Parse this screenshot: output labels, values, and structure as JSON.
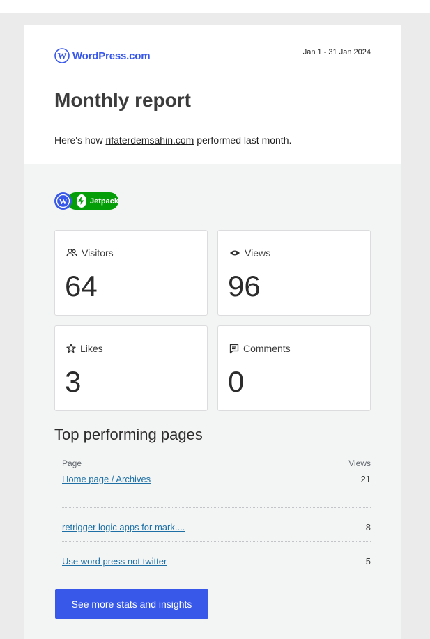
{
  "header": {
    "brand": "WordPress.com",
    "date_range": "Jan 1 - 31 Jan 2024",
    "title": "Monthly report",
    "intro_before": "Here's how ",
    "site_link": "rifaterdemsahin.com",
    "intro_after": " performed last month."
  },
  "badges": {
    "jetpack_label": "Jetpack"
  },
  "stats": [
    {
      "label": "Visitors",
      "value": "64",
      "icon": "people-icon"
    },
    {
      "label": "Views",
      "value": "96",
      "icon": "eye-icon"
    },
    {
      "label": "Likes",
      "value": "3",
      "icon": "star-icon"
    },
    {
      "label": "Comments",
      "value": "0",
      "icon": "comment-icon"
    }
  ],
  "top_pages": {
    "title": "Top performing pages",
    "col_page": "Page",
    "col_views": "Views",
    "rows": [
      {
        "page": "Home page / Archives",
        "views": "21"
      },
      {
        "page": "retrigger logic apps for mark....",
        "views": "8"
      },
      {
        "page": "Use word press not twitter",
        "views": "5"
      }
    ]
  },
  "cta": {
    "label": "See more stats and insights"
  },
  "colors": {
    "accent": "#3858e9",
    "jetpack": "#069e08",
    "link": "#1d6fa5"
  }
}
